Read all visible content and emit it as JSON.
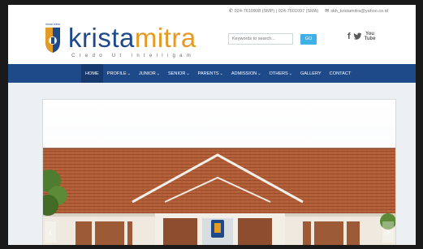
{
  "contact": {
    "phone": "024-7610998 (SMP) | 024-7601097 (SMA)",
    "email": "skh_kristamitra@yahoo.co.id"
  },
  "brand": {
    "name_part1": "krista",
    "name_part2": "mitra",
    "motto": "Credo Ut Intelligam",
    "crest_text": "krista mitra"
  },
  "search": {
    "placeholder": "Keywords to search...",
    "button_label": "GO"
  },
  "social": {
    "facebook": "f",
    "twitter": "🐦",
    "youtube_top": "You",
    "youtube_bottom": "Tube"
  },
  "nav": {
    "items": [
      {
        "label": "HOME",
        "dropdown": false
      },
      {
        "label": "PROFILE",
        "dropdown": true
      },
      {
        "label": "JUNIOR",
        "dropdown": true
      },
      {
        "label": "SENIOR",
        "dropdown": true
      },
      {
        "label": "PARENTS",
        "dropdown": true
      },
      {
        "label": "ADMISSION",
        "dropdown": true
      },
      {
        "label": "OTHERS",
        "dropdown": true
      },
      {
        "label": "GALLERY",
        "dropdown": false
      },
      {
        "label": "CONTACT",
        "dropdown": false
      }
    ],
    "active_index": 0,
    "caret": "⌄"
  },
  "slider": {
    "prev": "‹",
    "next": "›"
  },
  "colors": {
    "brand_blue": "#1f4a8a",
    "brand_orange": "#e49b24",
    "go_button": "#3fb0e8",
    "nav_active": "#173a6e"
  },
  "icons": {
    "phone": "phone-icon",
    "email": "envelope-icon"
  }
}
